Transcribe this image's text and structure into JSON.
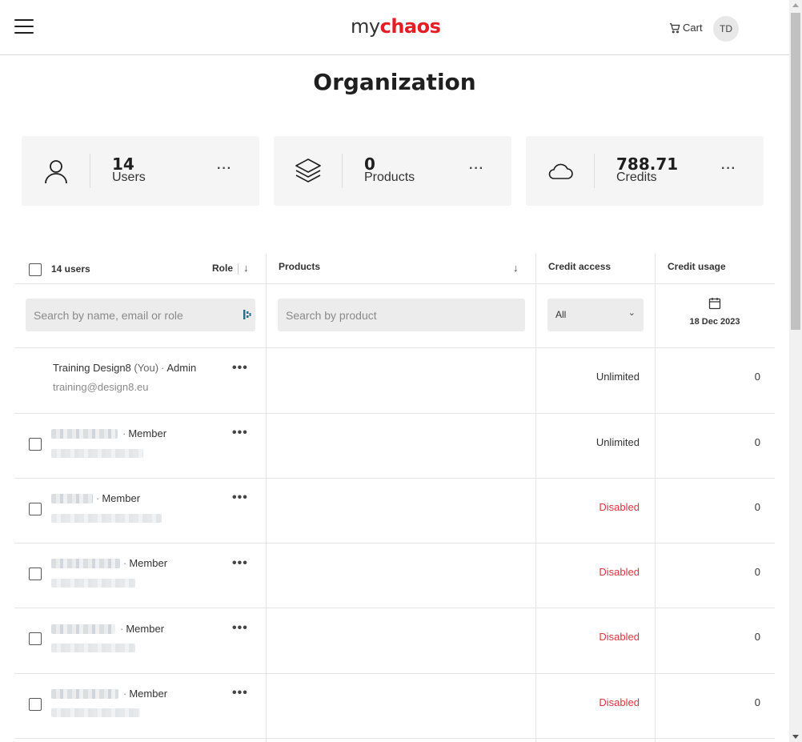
{
  "header": {
    "logo_my": "my",
    "logo_chaos": "chaos",
    "cart_label": "Cart",
    "avatar_initials": "TD"
  },
  "page": {
    "title": "Organization"
  },
  "stats": [
    {
      "value": "14",
      "label": "Users",
      "icon": "user-icon",
      "more": "···"
    },
    {
      "value": "0",
      "label": "Products",
      "icon": "layers-icon",
      "more": "···"
    },
    {
      "value": "788.71",
      "label": "Credits",
      "icon": "cloud-icon",
      "more": "···"
    }
  ],
  "table": {
    "headers": {
      "users_count": "14 users",
      "role": "Role",
      "products": "Products",
      "credit_access": "Credit access",
      "credit_usage": "Credit usage"
    },
    "filters": {
      "user_search_placeholder": "Search by name, email or role",
      "product_search_placeholder": "Search by product",
      "credit_access_value": "All",
      "date": "18 Dec 2023"
    },
    "rows": [
      {
        "name": "Training Design8",
        "you": "(You)",
        "role": "Admin",
        "email": "training@design8.eu",
        "access": "Unlimited",
        "usage": "0"
      },
      {
        "name": "",
        "you": "",
        "role": "Member",
        "email": "",
        "access": "Unlimited",
        "usage": "0"
      },
      {
        "name": "",
        "you": "",
        "role": "Member",
        "email": "",
        "access": "Disabled",
        "usage": "0"
      },
      {
        "name": "",
        "you": "",
        "role": "Member",
        "email": "",
        "access": "Disabled",
        "usage": "0"
      },
      {
        "name": "",
        "you": "",
        "role": "Member",
        "email": "",
        "access": "Disabled",
        "usage": "0"
      },
      {
        "name": "",
        "you": "",
        "role": "Member",
        "email": "",
        "access": "Disabled",
        "usage": "0"
      }
    ],
    "row_more": "•••",
    "separator": "·"
  },
  "colors": {
    "brand_red": "#e31e24",
    "disabled_red": "#d9363e",
    "card_bg": "#f5f5f5"
  }
}
